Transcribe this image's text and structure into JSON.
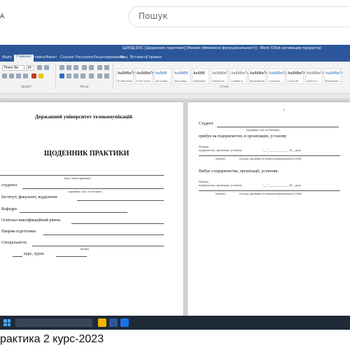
{
  "top": {
    "left_letter": "A",
    "search_placeholder": "Пошук"
  },
  "word": {
    "title": "ЩПОД.DOC  [Щоденник практики] [Режим обмеженої функціональності] - Word (Сбой активации продукта)",
    "tabs": [
      "Файл",
      "Вставка",
      "Макет",
      "Ссылки",
      "Рассылки",
      "Рецензирование",
      "Вид",
      "Вставить",
      "Справка"
    ],
    "active_tab": "Главная",
    "font_name": "Times Ne",
    "font_size": "14",
    "styles": [
      {
        "sample": "АаБбВвГг",
        "name": "¶ Обычный"
      },
      {
        "sample": "АаБбВвГг",
        "name": "¶ Без инте..."
      },
      {
        "sample": "АаБбВ",
        "name": "Заголово..."
      },
      {
        "sample": "АаБбВВ",
        "name": "Заголово..."
      },
      {
        "sample": "АаБбВ",
        "name": "Название"
      },
      {
        "sample": "АаБбВвГ",
        "name": "Подзагол..."
      },
      {
        "sample": "АаБбВвГг",
        "name": "Слабое в..."
      },
      {
        "sample": "АаБбВвГг",
        "name": "Выделение"
      },
      {
        "sample": "АаБбВвГг",
        "name": "Сильное..."
      },
      {
        "sample": "АаБбВвГг",
        "name": "Строгий"
      },
      {
        "sample": "АаБбВвГг",
        "name": "Цитата 2"
      },
      {
        "sample": "АаБбВвГг",
        "name": "Выделенн..."
      }
    ],
    "group_labels": [
      "Шрифт",
      "Абзац",
      "Стили"
    ]
  },
  "left_page": {
    "university": "Державний університет телекомунікацій",
    "heading": "ЩОДЕННИК ПРАКТИКИ",
    "practice_kind_caption": "(вид і назва практики)",
    "student_label": "студента",
    "student_caption": "(прізвище, ім'я, по батькові)",
    "institute_label": "Інститут, факультет, відділення",
    "department_label": "Кафедра",
    "level_label": "Освітньо-кваліфікаційний  рівень",
    "direction_label": "Напрям підготовки",
    "specialty_label": "Спеціальність",
    "specialty_caption": "(назва)",
    "course_label": "курс,  група"
  },
  "right_page": {
    "student_label": "Студент",
    "student_caption": "(прізвище, ім'я, по батькові)",
    "arrived_text": "прибув на підприємство, в організацію, установу",
    "stamp_label_1": "Печатка",
    "stamp_label_2": "підприємства, організації, установи",
    "date_text": "\"___\" ______________ 20__ року",
    "sign_caption": "(підпис)",
    "position_caption": "(посада, прізвище та ініціали відповідальної особи)",
    "left_text": "Вибув з підприємства, організації, установи.",
    "page_mark": "2"
  },
  "caption": "рактика 2 курс-2023"
}
